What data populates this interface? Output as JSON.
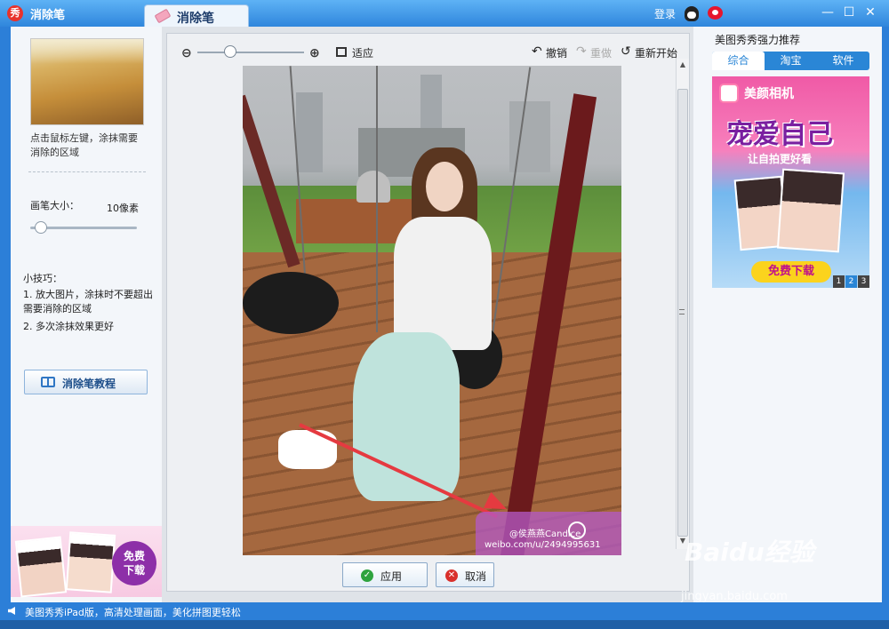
{
  "window": {
    "app_name": "消除笔",
    "tab_label": "消除笔",
    "login_label": "登录",
    "logo_glyph": "秀"
  },
  "left_panel": {
    "hint": "点击鼠标左键，涂抹需要消除的区域",
    "brush_size_label": "画笔大小：",
    "brush_size_value": "10像素",
    "tips_title": "小技巧：",
    "tip_1": "1. 放大图片，涂抹时不要超出需要消除的区域",
    "tip_2": "2. 多次涂抹效果更好",
    "tutorial_button": "消除笔教程",
    "promo_free": "免费",
    "promo_download": "下载"
  },
  "toolbar": {
    "fit_label": "适应",
    "undo_label": "撤销",
    "redo_label": "重做",
    "restart_label": "重新开始"
  },
  "photo": {
    "watermark_line1": "@侯燕燕Candice",
    "watermark_line2": "weibo.com/u/2494995631"
  },
  "actions": {
    "apply_label": "应用",
    "cancel_label": "取消"
  },
  "right_panel": {
    "title": "美图秀秀强力推荐",
    "tabs": [
      {
        "label": "综合",
        "active": true
      },
      {
        "label": "淘宝",
        "active": false
      },
      {
        "label": "软件",
        "active": false
      }
    ],
    "ad": {
      "brand": "美颜相机",
      "slogan": "宠爱自己",
      "sub": "让自拍更好看",
      "download": "免费下载"
    },
    "pages": [
      "1",
      "2",
      "3"
    ],
    "active_page": "2"
  },
  "status": {
    "text": "美图秀秀iPad版，高清处理画面，美化拼图更轻松"
  },
  "watermark": {
    "brand": "Baidu经验",
    "url": "jingyan.baidu.com"
  },
  "colors": {
    "titlebar": "#2f86dc",
    "accent": "#2a86d6",
    "arrow": "#e53a40"
  }
}
